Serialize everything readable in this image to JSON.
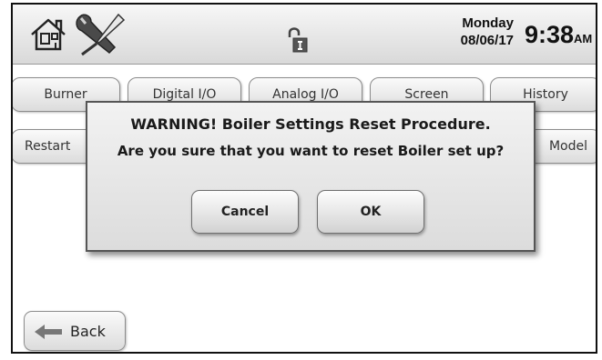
{
  "header": {
    "day": "Monday",
    "date": "08/06/17",
    "time": "9:38",
    "ampm": "AM",
    "home_icon": "home-icon",
    "tools_icon": "tools-icon",
    "lock_icon": "lock-icon"
  },
  "tabs": {
    "row1": [
      "Burner",
      "Digital I/O",
      "Analog I/O",
      "Screen",
      "History"
    ],
    "row2": [
      "Restart",
      "Model"
    ]
  },
  "dialog": {
    "title": "WARNING! Boiler Settings Reset Procedure.",
    "message": "Are you sure that you want to reset Boiler set up?",
    "cancel_label": "Cancel",
    "ok_label": "OK"
  },
  "footer": {
    "back_label": "Back",
    "back_icon": "left-arrow-icon"
  }
}
